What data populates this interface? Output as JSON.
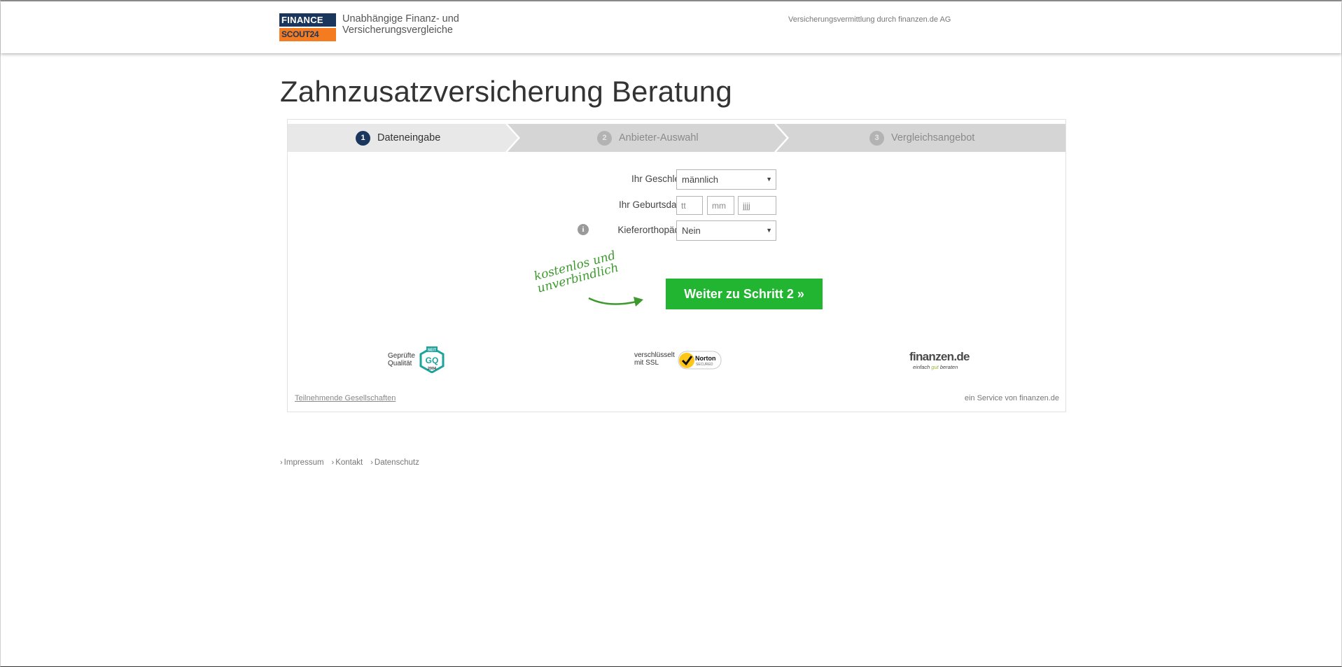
{
  "header": {
    "logo_top": "FINANCE",
    "logo_bottom": "SCOUT24",
    "tagline_line1": "Unabhängige Finanz- und",
    "tagline_line2": "Versicherungsvergleiche",
    "broker_note": "Versicherungsvermittlung durch finanzen.de AG"
  },
  "page": {
    "title": "Zahnzusatzversicherung Beratung"
  },
  "steps": [
    {
      "number": "1",
      "label": "Dateneingabe",
      "active": true
    },
    {
      "number": "2",
      "label": "Anbieter-Auswahl",
      "active": false
    },
    {
      "number": "3",
      "label": "Vergleichsangebot",
      "active": false
    }
  ],
  "form": {
    "gender_label": "Ihr Geschlecht",
    "gender_value": "männlich",
    "birthdate_label": "Ihr Geburtsdatum",
    "day_placeholder": "tt",
    "month_placeholder": "mm",
    "year_placeholder": "jjjj",
    "ortho_label": "Kieferorthopädie?",
    "ortho_value": "Nein",
    "info_icon_glyph": "i"
  },
  "cta": {
    "handwriting_line1": "kostenlos und",
    "handwriting_line2": "unverbindlich",
    "button_label": "Weiter zu Schritt 2 »",
    "button_color": "#21b531"
  },
  "badges": {
    "quality_line1": "Geprüfte",
    "quality_line2": "Qualität",
    "quality_seal_top": "SEIT",
    "quality_seal_mid": "GQ",
    "quality_seal_year": "2004",
    "ssl_line1": "verschlüsselt",
    "ssl_line2": "mit SSL",
    "norton_name": "Norton",
    "norton_sub": "SECURED",
    "finanzen_logo": "finanzen.de",
    "finanzen_claim_a": "einfach",
    "finanzen_claim_b": "gut",
    "finanzen_claim_c": "beraten"
  },
  "box_footer": {
    "participants_link": "Teilnehmende Gesellschaften",
    "service_note": "ein Service von finanzen.de"
  },
  "footer_links": [
    "Impressum",
    "Kontakt",
    "Datenschutz"
  ],
  "colors": {
    "brand_navy": "#1b365d",
    "brand_orange": "#f47b20",
    "step_active_bg": "#e8e8e8",
    "step_inactive_bg": "#d5d5d5",
    "handwriting_green": "#3c9a2d"
  }
}
